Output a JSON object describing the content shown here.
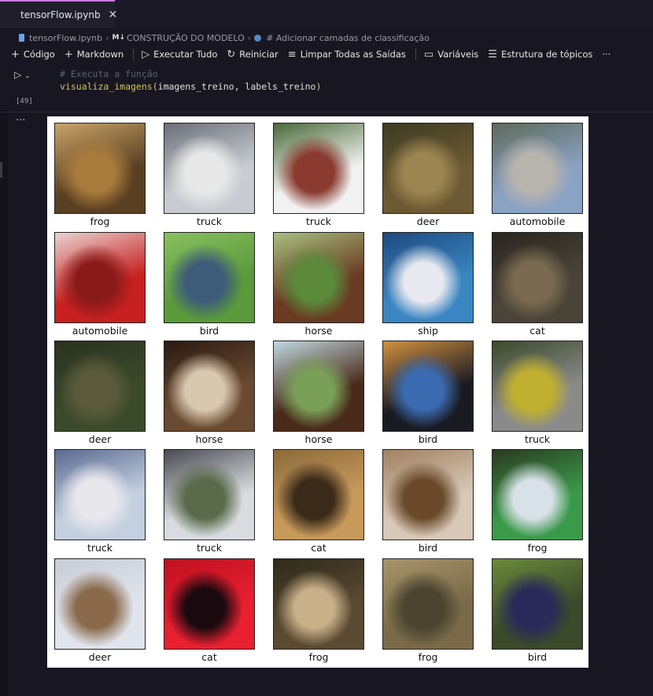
{
  "tab": {
    "title": "tensorFlow.ipynb",
    "close": "✕"
  },
  "breadcrumb": {
    "file": "tensorFlow.ipynb",
    "md_tag": "M↓",
    "section": "CONSTRUÇÃO DO MODELO",
    "cell": "# Adicionar camadas de classificação"
  },
  "toolbar": {
    "code": "Código",
    "markdown": "Markdown",
    "run_all": "Executar Tudo",
    "restart": "Reiniciar",
    "clear": "Limpar Todas as Saídas",
    "variables": "Variáveis",
    "outline": "Estrutura de tópicos",
    "more": "···"
  },
  "cell": {
    "count": "[49]",
    "comment": "# Executa a função",
    "fn": "visualiza_imagens",
    "open_paren": "(",
    "args": "imagens_treino, labels_treino",
    "close_paren": ")"
  },
  "output": {
    "more": "···",
    "grid": [
      {
        "label": "frog",
        "colors": [
          "#5a4022",
          "#a87a3c",
          "#c9a46a"
        ]
      },
      {
        "label": "truck",
        "colors": [
          "#c8ccd2",
          "#e8e8e8",
          "#6b6f78"
        ]
      },
      {
        "label": "truck",
        "colors": [
          "#f2f2f2",
          "#8a3a2e",
          "#4a6a3a"
        ]
      },
      {
        "label": "deer",
        "colors": [
          "#6c5a34",
          "#9c8550",
          "#3d3a22"
        ]
      },
      {
        "label": "automobile",
        "colors": [
          "#8aa2c4",
          "#b7b3ad",
          "#5d6a5a"
        ]
      },
      {
        "label": "automobile",
        "colors": [
          "#c82020",
          "#8a1a1a",
          "#e8d4d0"
        ]
      },
      {
        "label": "bird",
        "colors": [
          "#5a9a3a",
          "#3e5c7a",
          "#8ac060"
        ]
      },
      {
        "label": "horse",
        "colors": [
          "#6a3a22",
          "#5a8a3a",
          "#a8c080"
        ]
      },
      {
        "label": "ship",
        "colors": [
          "#3a86c2",
          "#e8e8f0",
          "#1e4a80"
        ]
      },
      {
        "label": "cat",
        "colors": [
          "#4a4438",
          "#7a6a50",
          "#2a2620"
        ]
      },
      {
        "label": "deer",
        "colors": [
          "#3a4a2a",
          "#5a5a3a",
          "#2a3220"
        ]
      },
      {
        "label": "horse",
        "colors": [
          "#6a4a30",
          "#d8c8b0",
          "#2a1a12"
        ]
      },
      {
        "label": "horse",
        "colors": [
          "#4a2a1a",
          "#7aa058",
          "#c0d8e0"
        ]
      },
      {
        "label": "bird",
        "colors": [
          "#1a1a22",
          "#3a6ab0",
          "#d09040"
        ]
      },
      {
        "label": "truck",
        "colors": [
          "#8a8a8a",
          "#c0b030",
          "#3a4a2a"
        ]
      },
      {
        "label": "truck",
        "colors": [
          "#c4d0e0",
          "#e8e8ec",
          "#5a6a90"
        ]
      },
      {
        "label": "truck",
        "colors": [
          "#d8dce0",
          "#5a6a4a",
          "#4a4a52"
        ]
      },
      {
        "label": "cat",
        "colors": [
          "#c89a5a",
          "#3a2a1a",
          "#8a6a3a"
        ]
      },
      {
        "label": "bird",
        "colors": [
          "#d8c8b8",
          "#6a4a2a",
          "#a08060"
        ]
      },
      {
        "label": "frog",
        "colors": [
          "#3a9a4a",
          "#d8e0e8",
          "#2a3a20"
        ]
      },
      {
        "label": "deer",
        "colors": [
          "#e0e4ec",
          "#8a6a4a",
          "#c8ccd4"
        ]
      },
      {
        "label": "cat",
        "colors": [
          "#e82030",
          "#1a0a10",
          "#c01020"
        ]
      },
      {
        "label": "frog",
        "colors": [
          "#5a4a32",
          "#c8b088",
          "#2e2a1a"
        ]
      },
      {
        "label": "frog",
        "colors": [
          "#7a6a48",
          "#4a4430",
          "#a8946a"
        ]
      },
      {
        "label": "bird",
        "colors": [
          "#3a4a2a",
          "#2a2a5a",
          "#6a8a3a"
        ]
      }
    ]
  }
}
